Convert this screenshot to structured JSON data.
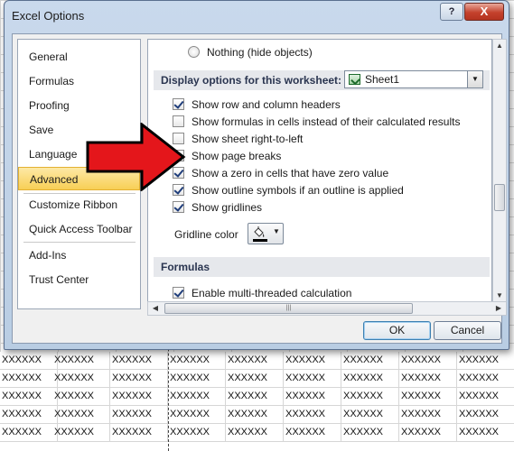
{
  "sheet": {
    "cell_text": "XXXXXX"
  },
  "dialog": {
    "title": "Excel Options",
    "help_label": "?",
    "close_label": "X",
    "ok_label": "OK",
    "cancel_label": "Cancel"
  },
  "nav": {
    "items": [
      {
        "label": "General"
      },
      {
        "label": "Formulas"
      },
      {
        "label": "Proofing"
      },
      {
        "label": "Save"
      },
      {
        "label": "Language"
      },
      {
        "label": "Advanced",
        "active": true
      },
      {
        "label": "Customize Ribbon"
      },
      {
        "label": "Quick Access Toolbar"
      },
      {
        "label": "Add-Ins"
      },
      {
        "label": "Trust Center"
      }
    ]
  },
  "panel": {
    "radio_nothing": "Nothing (hide objects)",
    "worksheet_section_title": "Display options for this worksheet:",
    "worksheet_selected": "Sheet1",
    "options": [
      {
        "label": "Show row and column headers",
        "checked": true
      },
      {
        "label": "Show formulas in cells instead of their calculated results",
        "checked": false
      },
      {
        "label": "Show sheet right-to-left",
        "checked": false
      },
      {
        "label": "Show page breaks",
        "checked": false
      },
      {
        "label": "Show a zero in cells that have zero value",
        "checked": true
      },
      {
        "label": "Show outline symbols if an outline is applied",
        "checked": true
      },
      {
        "label": "Show gridlines",
        "checked": true
      }
    ],
    "gridline_color_label": "Gridline color",
    "gridline_color": "#000000",
    "formulas_section_title": "Formulas",
    "formulas_options": [
      {
        "label": "Enable multi-threaded calculation",
        "checked": true
      }
    ]
  },
  "colors": {
    "nav_active": "#f8cf55",
    "arrow": "#e4161b",
    "section_header": "#e6e8ec"
  }
}
